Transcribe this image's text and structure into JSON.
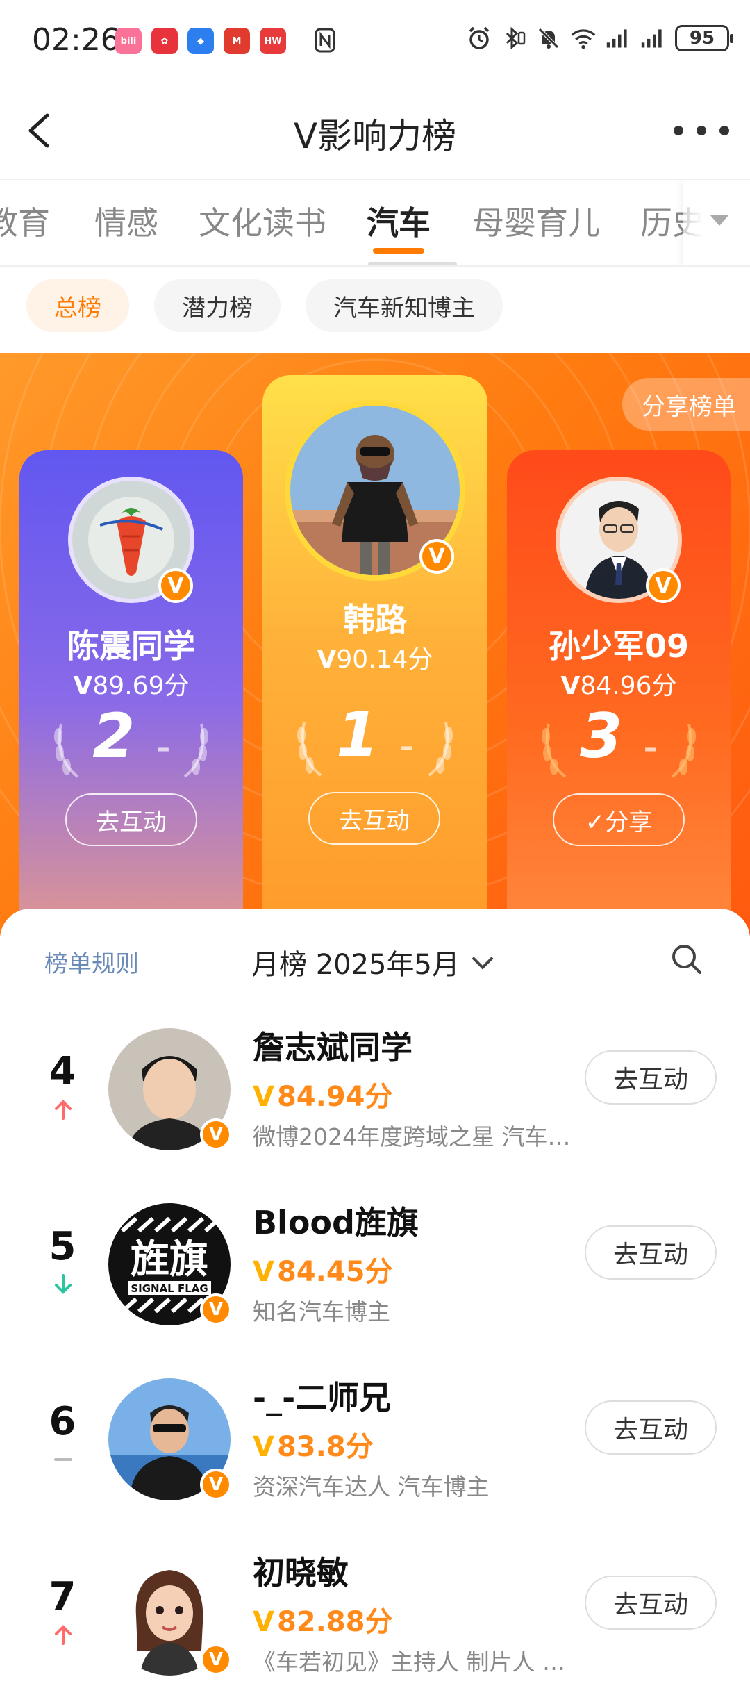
{
  "status_bar": {
    "time": "02:26",
    "battery": "95",
    "app_icons": [
      {
        "name": "bilibili-icon",
        "color": "#fb7299",
        "label": "bili"
      },
      {
        "name": "flower-app-icon",
        "color": "#e8323c",
        "label": "✿"
      },
      {
        "name": "shield-app-icon",
        "color": "#2d7ff0",
        "label": "◆"
      },
      {
        "name": "metro-app-icon",
        "color": "#e13a2e",
        "label": "M"
      },
      {
        "name": "huawei-app-icon",
        "color": "#e83a3a",
        "label": "HW"
      }
    ]
  },
  "navbar": {
    "title": "V影响力榜"
  },
  "tabs": [
    {
      "label": "教育"
    },
    {
      "label": "情感"
    },
    {
      "label": "文化读书"
    },
    {
      "label": "汽车",
      "active": true
    },
    {
      "label": "母婴育儿"
    },
    {
      "label": "历史"
    }
  ],
  "chips": [
    {
      "label": "总榜",
      "active": true
    },
    {
      "label": "潜力榜"
    },
    {
      "label": "汽车新知博主"
    }
  ],
  "banner": {
    "share_list_label": "分享榜单",
    "top3": [
      {
        "rank": "2",
        "name": "陈震同学",
        "score": "89.69分",
        "button": "去互动"
      },
      {
        "rank": "1",
        "name": "韩路",
        "score": "90.14分",
        "button": "去互动"
      },
      {
        "rank": "3",
        "name": "孙少军09",
        "score": "84.96分",
        "button": "✓分享"
      }
    ],
    "v_mark": "V",
    "rank_suffix": "–"
  },
  "list_header": {
    "rules_label": "榜单规则",
    "period_label": "月榜 2025年5月"
  },
  "rows": [
    {
      "rank": "4",
      "trend": "up",
      "name": "詹志斌同学",
      "score": "84.94分",
      "desc": "微博2024年度跨域之星 汽车…",
      "button": "去互动"
    },
    {
      "rank": "5",
      "trend": "down",
      "name": "Blood旌旗",
      "score": "84.45分",
      "desc": "知名汽车博主",
      "button": "去互动"
    },
    {
      "rank": "6",
      "trend": "same",
      "name": "-_-二师兄",
      "score": "83.8分",
      "desc": "资深汽车达人 汽车博主",
      "button": "去互动"
    },
    {
      "rank": "7",
      "trend": "up",
      "name": "初晓敏",
      "score": "82.88分",
      "desc": "《车若初见》主持人 制片人 …",
      "button": "去互动"
    }
  ],
  "colors": {
    "accent": "#ff7a00",
    "trend_up": "#ff6a6a",
    "trend_down": "#2ec4a0",
    "trend_same": "#bbbbbb"
  }
}
